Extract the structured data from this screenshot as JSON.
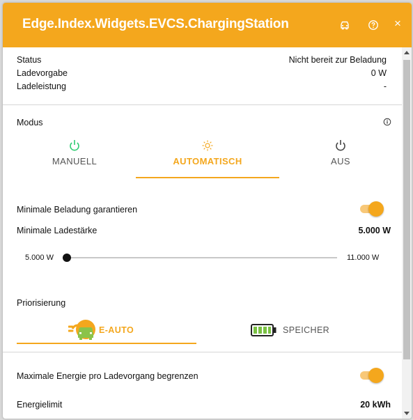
{
  "header": {
    "title": "Edge.Index.Widgets.EVCS.ChargingStation",
    "icons": [
      "car-icon",
      "help-icon",
      "close-icon"
    ],
    "close_label": "×"
  },
  "status_section": {
    "status_label": "Status",
    "status_value": "Nicht bereit zur Beladung",
    "ladevorgabe_label": "Ladevorgabe",
    "ladevorgabe_value": "0 W",
    "ladeleistung_label": "Ladeleistung",
    "ladeleistung_value": "-"
  },
  "mode_section": {
    "label": "Modus",
    "info_icon": "info-icon",
    "tabs": [
      {
        "label": "MANUELL",
        "icon": "power-icon",
        "color": "#2ecc71",
        "active": false
      },
      {
        "label": "AUTOMATISCH",
        "icon": "sun-icon",
        "color": "#f4a71d",
        "active": true
      },
      {
        "label": "AUS",
        "icon": "power-icon",
        "color": "#444444",
        "active": false
      }
    ]
  },
  "minimum_charge": {
    "toggle_label": "Minimale Beladung garantieren",
    "toggle_on": true,
    "strength_label": "Minimale Ladestärke",
    "strength_value": "5.000 W",
    "slider_min_label": "5.000 W",
    "slider_max_label": "11.000 W",
    "slider_fraction": 0.0
  },
  "priority": {
    "label": "Priorisierung",
    "tabs": [
      {
        "label": "E-AUTO",
        "icon": "ev-car-icon",
        "active": true
      },
      {
        "label": "SPEICHER",
        "icon": "battery-icon",
        "active": false
      }
    ]
  },
  "energy_limit": {
    "toggle_label": "Maximale Energie pro Ladevorgang begrenzen",
    "toggle_on": true,
    "limit_label": "Energielimit",
    "limit_value": "20 kWh"
  },
  "colors": {
    "accent": "#f4a71d",
    "green": "#2ecc71"
  }
}
